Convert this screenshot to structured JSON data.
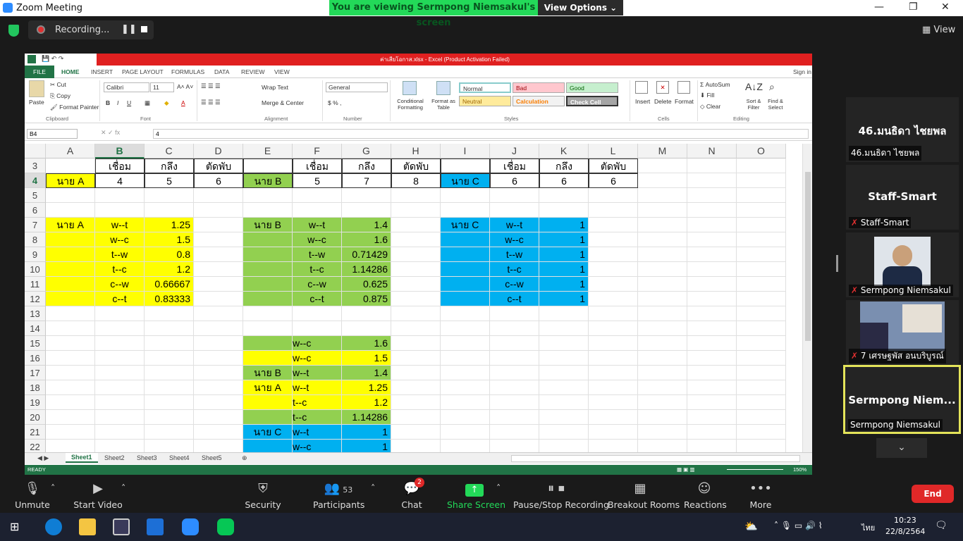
{
  "window": {
    "title": "Zoom Meeting",
    "banner": "You are viewing Sermpong Niemsakul's screen",
    "view_options": "View Options",
    "view_label": "View"
  },
  "recording": {
    "label": "Recording..."
  },
  "excel": {
    "title": "ค่าเสียโอกาส.xlsx - Excel (Product Activation Failed)",
    "tabs": [
      "FILE",
      "HOME",
      "INSERT",
      "PAGE LAYOUT",
      "FORMULAS",
      "DATA",
      "REVIEW",
      "VIEW"
    ],
    "signin": "Sign in",
    "ribbon": {
      "paste": "Paste",
      "cut": "Cut",
      "copy": "Copy",
      "format_painter": "Format Painter",
      "clipboard": "Clipboard",
      "font_name": "Calibri",
      "font_size": "11",
      "font": "Font",
      "wrap_text": "Wrap Text",
      "merge_center": "Merge & Center",
      "alignment": "Alignment",
      "number_format": "General",
      "number": "Number",
      "conditional": "Conditional Formatting",
      "format_table": "Format as Table",
      "style_normal": "Normal",
      "style_bad": "Bad",
      "style_good": "Good",
      "style_neutral": "Neutral",
      "style_calc": "Calculation",
      "style_check": "Check Cell",
      "styles": "Styles",
      "insert": "Insert",
      "delete": "Delete",
      "format": "Format",
      "cells": "Cells",
      "autosum": "AutoSum",
      "fill": "Fill",
      "clear": "Clear",
      "sort": "Sort & Filter",
      "find": "Find & Select",
      "editing": "Editing"
    },
    "namebox": "B4",
    "formula": "4",
    "columns": [
      "A",
      "B",
      "C",
      "D",
      "E",
      "F",
      "G",
      "H",
      "I",
      "J",
      "K",
      "L",
      "M",
      "N",
      "O"
    ],
    "rows": [
      "3",
      "4",
      "5",
      "6",
      "7",
      "8",
      "9",
      "10",
      "11",
      "12",
      "13",
      "14",
      "15",
      "16",
      "17",
      "18",
      "19",
      "20",
      "21",
      "22"
    ],
    "cells": {
      "b3": "เชื่อม",
      "c3": "กลึง",
      "d3": "ตัดพับ",
      "f3": "เชื่อม",
      "g3": "กลึง",
      "h3": "ตัดพับ",
      "j3": "เชื่อม",
      "k3": "กลึง",
      "l3": "ตัดพับ",
      "a4": "นาย A",
      "b4": "4",
      "c4": "5",
      "d4": "6",
      "e4": "นาย B",
      "f4": "5",
      "g4": "7",
      "h4": "8",
      "i4": "นาย C",
      "j4": "6",
      "k4": "6",
      "l4": "6",
      "a7": "นาย A",
      "e7": "นาย B",
      "i7": "นาย C",
      "blockA": [
        [
          "w--t",
          "1.25"
        ],
        [
          "w--c",
          "1.5"
        ],
        [
          "t--w",
          "0.8"
        ],
        [
          "t--c",
          "1.2"
        ],
        [
          "c--w",
          "0.66667"
        ],
        [
          "c--t",
          "0.83333"
        ]
      ],
      "blockB": [
        [
          "w--t",
          "1.4"
        ],
        [
          "w--c",
          "1.6"
        ],
        [
          "t--w",
          "0.71429"
        ],
        [
          "t--c",
          "1.14286"
        ],
        [
          "c--w",
          "0.625"
        ],
        [
          "c--t",
          "0.875"
        ]
      ],
      "blockC": [
        [
          "w--t",
          "1"
        ],
        [
          "w--c",
          "1"
        ],
        [
          "t--w",
          "1"
        ],
        [
          "t--c",
          "1"
        ],
        [
          "c--w",
          "1"
        ],
        [
          "c--t",
          "1"
        ]
      ],
      "rank": [
        [
          "",
          "w--c",
          "1.6"
        ],
        [
          "",
          "w--c",
          "1.5"
        ],
        [
          "นาย B",
          "w--t",
          "1.4"
        ],
        [
          "นาย A",
          "w--t",
          "1.25"
        ],
        [
          "",
          "t--c",
          "1.2"
        ],
        [
          "",
          "t--c",
          "1.14286"
        ],
        [
          "นาย C",
          "w--t",
          "1"
        ],
        [
          "",
          "w--c",
          "1"
        ]
      ]
    },
    "sheets": [
      "Sheet1",
      "Sheet2",
      "Sheet3",
      "Sheet4",
      "Sheet5"
    ],
    "status": "READY",
    "zoom": "150%",
    "colors": {
      "yellow": "#ffff00",
      "green": "#92d050",
      "blue": "#00b0f0",
      "excel_green": "#217346"
    }
  },
  "participants_panel": [
    {
      "big": "46.มนธิดา ไชยพล",
      "name": "46.มนธิดา ไชยพล"
    },
    {
      "big": "Staff-Smart",
      "name": "Staff-Smart"
    },
    {
      "big": "",
      "name": "Sermpong Niemsakul"
    },
    {
      "big": "",
      "name": "7 เศรษฐพัส อนบริบูรณ์"
    },
    {
      "big": "Sermpong  Niem...",
      "name": "Sermpong Niemsakul"
    }
  ],
  "toolbar": {
    "unmute": "Unmute",
    "start_video": "Start Video",
    "security": "Security",
    "participants": "Participants",
    "participants_count": "53",
    "chat": "Chat",
    "chat_badge": "2",
    "share": "Share Screen",
    "pause_rec": "Pause/Stop Recording",
    "breakout": "Breakout Rooms",
    "reactions": "Reactions",
    "more": "More",
    "end": "End"
  },
  "taskbar": {
    "time": "10:23",
    "date": "22/8/2564",
    "lang": "ไทย"
  }
}
